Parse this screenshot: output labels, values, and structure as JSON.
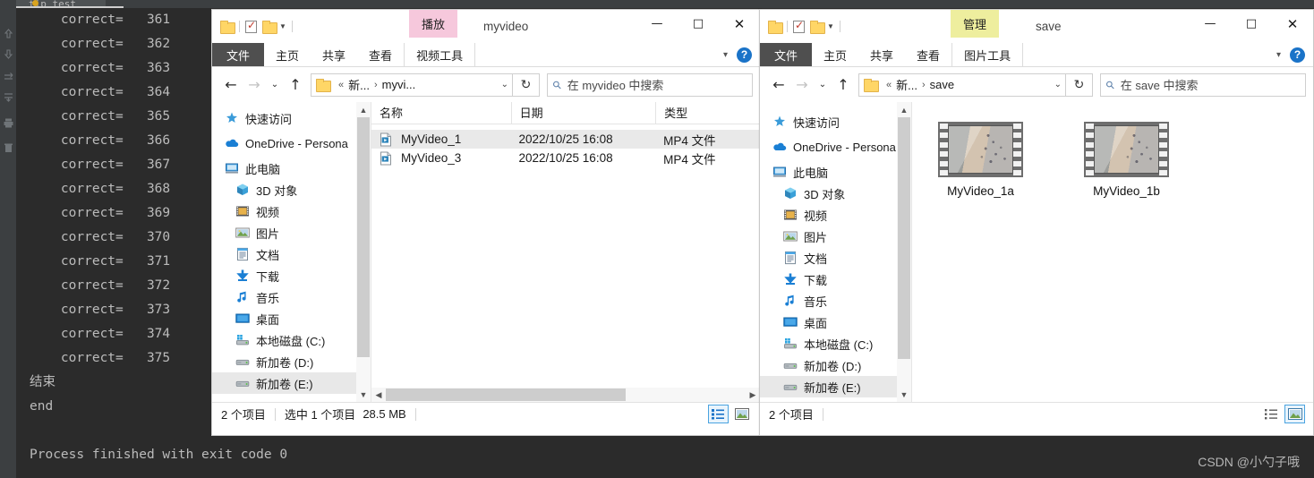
{
  "ide": {
    "tab_label": "tip_test",
    "toolbar_icons": [
      "arrow-up-icon",
      "arrow-down-icon",
      "rerun-icon",
      "soft-wrap-icon",
      "print-icon",
      "trash-icon"
    ],
    "console_lines": [
      "    correct=   361",
      "    correct=   362",
      "    correct=   363",
      "    correct=   364",
      "    correct=   365",
      "    correct=   366",
      "    correct=   367",
      "    correct=   368",
      "    correct=   369",
      "    correct=   370",
      "    correct=   371",
      "    correct=   372",
      "    correct=   373",
      "    correct=   374",
      "    correct=   375",
      "结束",
      "end",
      "",
      "Process finished with exit code 0"
    ],
    "watermark": "CSDN @小勺子哦"
  },
  "colors": {
    "accent_pink": "#f6c8dc",
    "accent_yellow": "#eeee9e",
    "file_tab": "#4f4f4f",
    "help_blue": "#1a73c8",
    "selection": "#e9e9e9",
    "view_active": "#4aa3e0",
    "console_bg": "#2b2b2b",
    "console_text": "#bbbbbb"
  },
  "window1": {
    "name": "myvideo",
    "context_tab_highlight": "播放",
    "quick_access": [
      "folder-icon",
      "properties-check-icon",
      "new-folder-icon",
      "customize-caret-icon"
    ],
    "caption_buttons": [
      "minimize-icon",
      "maximize-icon",
      "close-icon"
    ],
    "ribbon_tabs": [
      "文件",
      "主页",
      "共享",
      "查看"
    ],
    "ribbon_context_tab": "视频工具",
    "ribbon_collapse": "chevron-down-icon",
    "ribbon_help": "?",
    "nav": {
      "back": "←",
      "forward": "→",
      "recent": "⌄",
      "up": "↑",
      "breadcrumbs": [
        "新...",
        "myvi..."
      ],
      "breadcrumb_prefix": "«",
      "dropdown": "⌄",
      "refresh": "↻",
      "search_placeholder": "在 myvideo 中搜索"
    },
    "nav_pane": [
      {
        "label": "快速访问",
        "icon": "pin-star-icon",
        "indent": false
      },
      {
        "label": "OneDrive - Persona",
        "icon": "onedrive-cloud-icon",
        "indent": false
      },
      {
        "label": "此电脑",
        "icon": "this-pc-icon",
        "indent": false
      },
      {
        "label": "3D 对象",
        "icon": "3d-objects-icon",
        "indent": true
      },
      {
        "label": "视频",
        "icon": "videos-icon",
        "indent": true
      },
      {
        "label": "图片",
        "icon": "pictures-icon",
        "indent": true
      },
      {
        "label": "文档",
        "icon": "documents-icon",
        "indent": true
      },
      {
        "label": "下载",
        "icon": "downloads-icon",
        "indent": true
      },
      {
        "label": "音乐",
        "icon": "music-icon",
        "indent": true
      },
      {
        "label": "桌面",
        "icon": "desktop-icon",
        "indent": true
      },
      {
        "label": "本地磁盘 (C:)",
        "icon": "local-disk-icon",
        "indent": true
      },
      {
        "label": "新加卷 (D:)",
        "icon": "drive-icon",
        "indent": true
      },
      {
        "label": "新加卷 (E:)",
        "icon": "drive-icon",
        "indent": true
      }
    ],
    "columns": [
      "名称",
      "日期",
      "类型"
    ],
    "rows": [
      {
        "name": "MyVideo_1",
        "date": "2022/10/25 16:08",
        "type": "MP4 文件",
        "selected": true
      },
      {
        "name": "MyVideo_3",
        "date": "2022/10/25 16:08",
        "type": "MP4 文件",
        "selected": false
      }
    ],
    "status": {
      "count": "2 个项目",
      "selection": "选中 1 个项目",
      "size": "28.5 MB",
      "view_details": "details-view-icon",
      "view_large": "large-icons-view-icon",
      "active_view": "details"
    }
  },
  "window2": {
    "name": "save",
    "context_tab_highlight": "管理",
    "quick_access": [
      "folder-icon",
      "properties-check-icon",
      "new-folder-icon",
      "customize-caret-icon"
    ],
    "caption_buttons": [
      "minimize-icon",
      "maximize-icon",
      "close-icon"
    ],
    "ribbon_tabs": [
      "文件",
      "主页",
      "共享",
      "查看"
    ],
    "ribbon_context_tab": "图片工具",
    "ribbon_collapse": "chevron-down-icon",
    "ribbon_help": "?",
    "nav": {
      "back": "←",
      "forward": "→",
      "recent": "⌄",
      "up": "↑",
      "breadcrumbs": [
        "新...",
        "save"
      ],
      "breadcrumb_prefix": "«",
      "dropdown": "⌄",
      "refresh": "↻",
      "search_placeholder": "在 save 中搜索"
    },
    "nav_pane": [
      {
        "label": "快速访问",
        "icon": "pin-star-icon",
        "indent": false
      },
      {
        "label": "OneDrive - Persona",
        "icon": "onedrive-cloud-icon",
        "indent": false
      },
      {
        "label": "此电脑",
        "icon": "this-pc-icon",
        "indent": false
      },
      {
        "label": "3D 对象",
        "icon": "3d-objects-icon",
        "indent": true
      },
      {
        "label": "视频",
        "icon": "videos-icon",
        "indent": true
      },
      {
        "label": "图片",
        "icon": "pictures-icon",
        "indent": true
      },
      {
        "label": "文档",
        "icon": "documents-icon",
        "indent": true
      },
      {
        "label": "下载",
        "icon": "downloads-icon",
        "indent": true
      },
      {
        "label": "音乐",
        "icon": "music-icon",
        "indent": true
      },
      {
        "label": "桌面",
        "icon": "desktop-icon",
        "indent": true
      },
      {
        "label": "本地磁盘 (C:)",
        "icon": "local-disk-icon",
        "indent": true
      },
      {
        "label": "新加卷 (D:)",
        "icon": "drive-icon",
        "indent": true
      },
      {
        "label": "新加卷 (E:)",
        "icon": "drive-icon",
        "indent": true
      }
    ],
    "thumbnails": [
      {
        "label": "MyVideo_1a",
        "icon": "film-thumbnail"
      },
      {
        "label": "MyVideo_1b",
        "icon": "film-thumbnail"
      }
    ],
    "status": {
      "count": "2 个项目",
      "view_details": "details-view-icon",
      "view_large": "large-icons-view-icon",
      "active_view": "large"
    }
  }
}
